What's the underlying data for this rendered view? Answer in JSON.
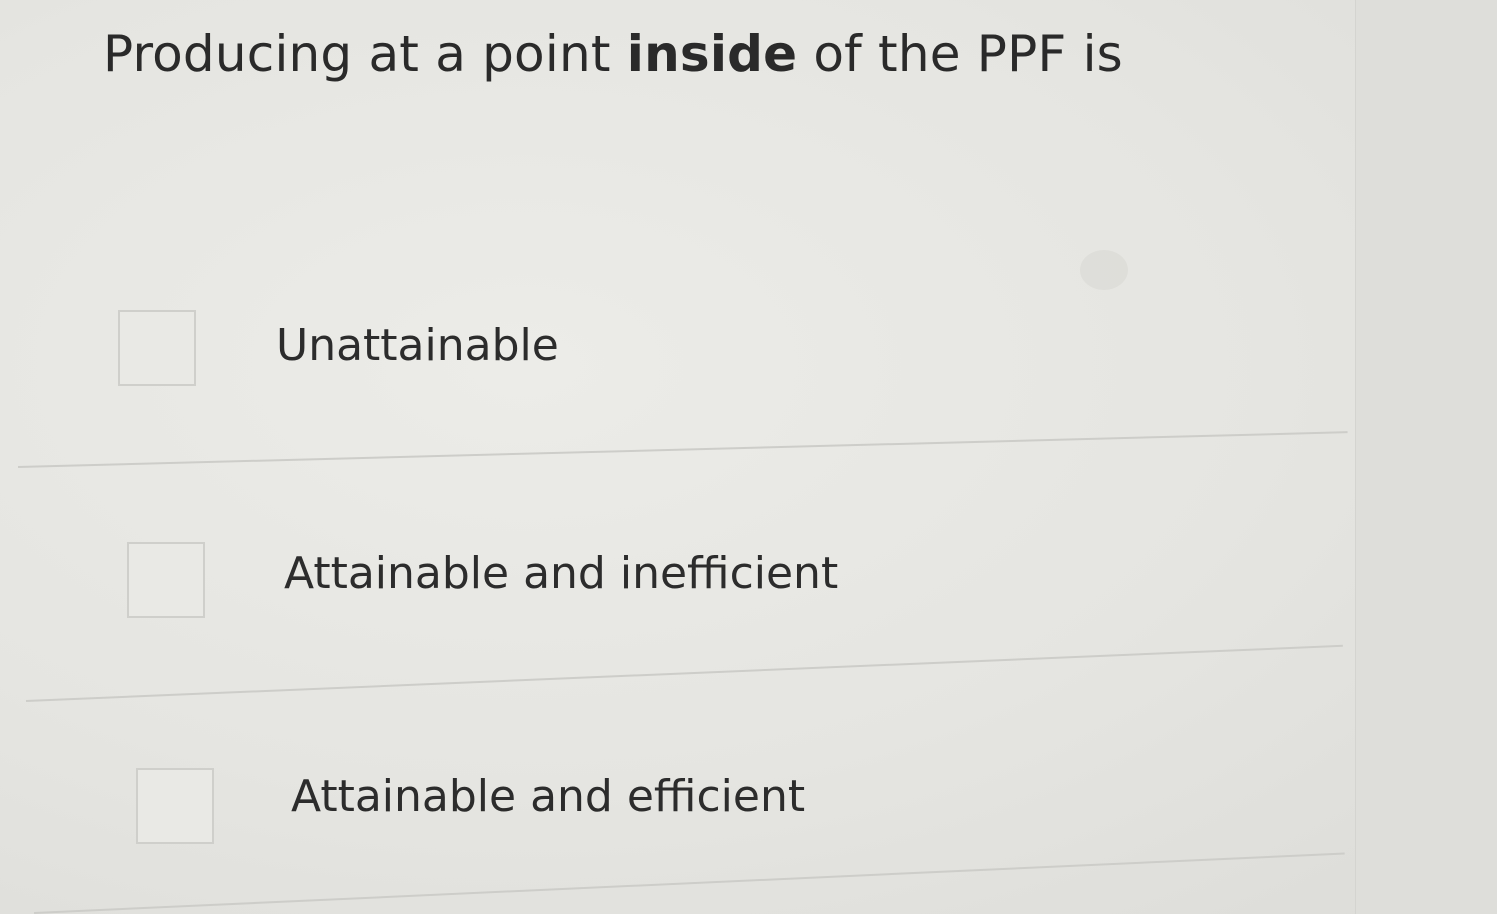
{
  "question": {
    "prefix": "Producing at a point ",
    "emphasis": "inside",
    "suffix": " of the PPF is"
  },
  "options": [
    {
      "label": "Unattainable",
      "checked": false
    },
    {
      "label": "Attainable and inefficient",
      "checked": false
    },
    {
      "label": "Attainable and efficient",
      "checked": false
    }
  ]
}
